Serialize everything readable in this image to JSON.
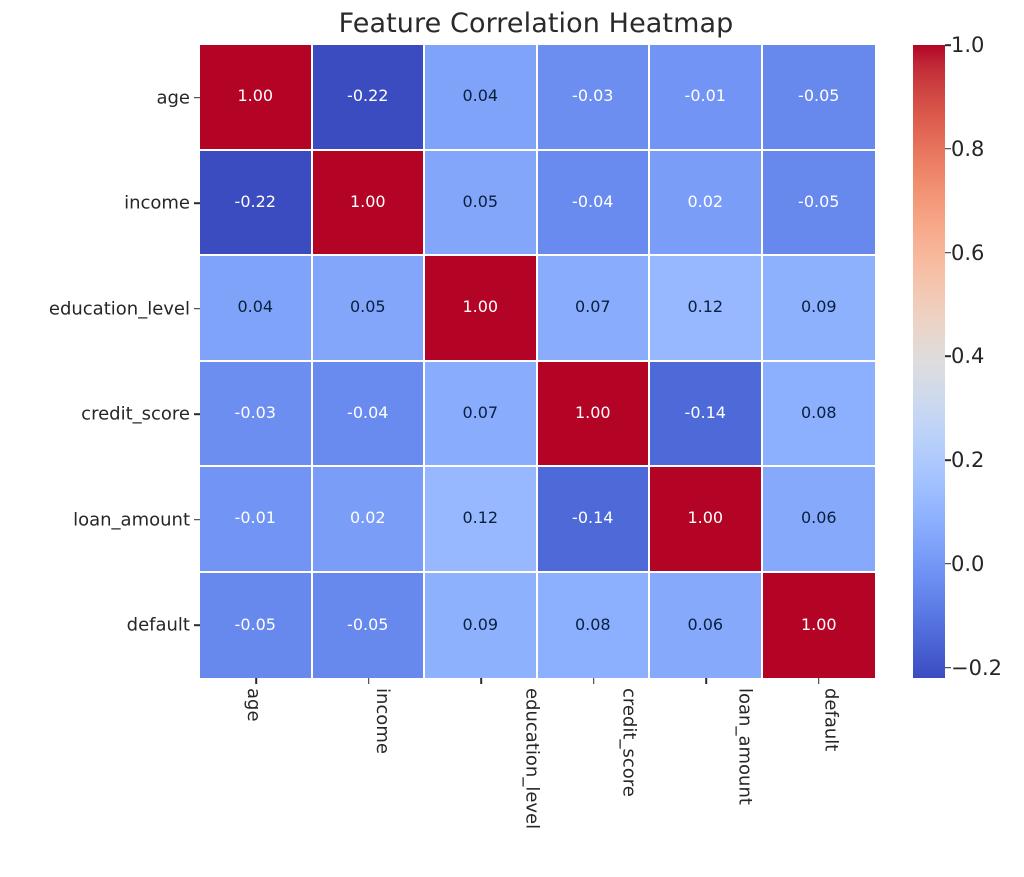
{
  "chart_data": {
    "type": "heatmap",
    "title": "Feature Correlation Heatmap",
    "xlabel": "",
    "ylabel": "",
    "colormap": "coolwarm",
    "grid": false,
    "annotated": true,
    "annotation_format": "0.00",
    "x_categories": [
      "age",
      "income",
      "education_level",
      "credit_score",
      "loan_amount",
      "default"
    ],
    "y_categories": [
      "age",
      "income",
      "education_level",
      "credit_score",
      "loan_amount",
      "default"
    ],
    "values": [
      [
        1.0,
        -0.22,
        0.04,
        -0.03,
        -0.01,
        -0.05
      ],
      [
        -0.22,
        1.0,
        0.05,
        -0.04,
        0.02,
        -0.05
      ],
      [
        0.04,
        0.05,
        1.0,
        0.07,
        0.12,
        0.09
      ],
      [
        -0.03,
        -0.04,
        0.07,
        1.0,
        -0.14,
        0.08
      ],
      [
        -0.01,
        0.02,
        0.12,
        -0.14,
        1.0,
        0.06
      ],
      [
        -0.05,
        -0.05,
        0.09,
        0.08,
        0.06,
        1.0
      ]
    ],
    "cell_labels": [
      [
        "1.00",
        "-0.22",
        "0.04",
        "-0.03",
        "-0.01",
        "-0.05"
      ],
      [
        "-0.22",
        "1.00",
        "0.05",
        "-0.04",
        "0.02",
        "-0.05"
      ],
      [
        "0.04",
        "0.05",
        "1.00",
        "0.07",
        "0.12",
        "0.09"
      ],
      [
        "-0.03",
        "-0.04",
        "0.07",
        "1.00",
        "-0.14",
        "0.08"
      ],
      [
        "-0.01",
        "0.02",
        "0.12",
        "-0.14",
        "1.00",
        "0.06"
      ],
      [
        "-0.05",
        "-0.05",
        "0.09",
        "0.08",
        "0.06",
        "1.00"
      ]
    ],
    "vmin": -0.22,
    "vmax": 1.0,
    "colorbar": {
      "position": "right",
      "ticks": [
        1.0,
        0.8,
        0.6,
        0.4,
        0.2,
        0.0,
        -0.2
      ],
      "tick_labels": [
        "1.0",
        "0.8",
        "0.6",
        "0.4",
        "0.2",
        "0.0",
        "−0.2"
      ],
      "range": [
        -0.22,
        1.0
      ]
    },
    "colors": {
      "max": "#b40426",
      "mid": "#dddcdc",
      "min": "#3b4cc0",
      "background": "#ffffff",
      "text": "#262626",
      "gridline": "#ffffff"
    }
  }
}
